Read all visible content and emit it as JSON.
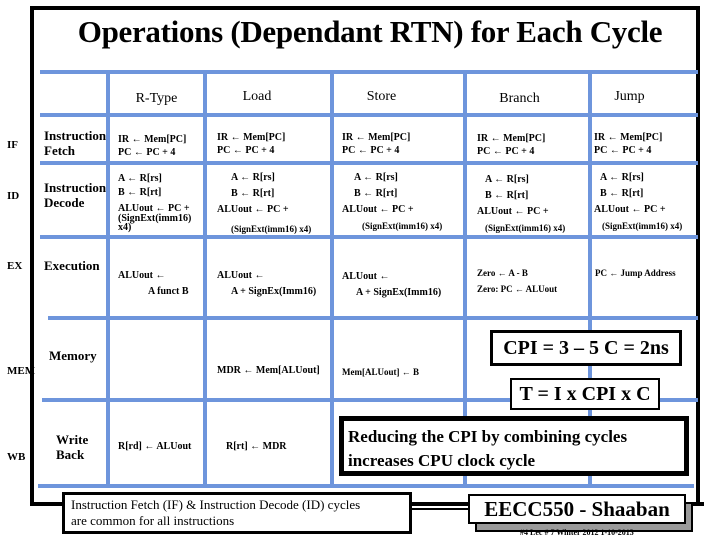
{
  "title": "Operations (Dependant RTN) for Each Cycle",
  "columns": [
    "R-Type",
    "Load",
    "Store",
    "Branch",
    "Jump"
  ],
  "stages": [
    {
      "abbr": "IF",
      "name_lines": [
        "Instruction",
        "Fetch"
      ]
    },
    {
      "abbr": "ID",
      "name_lines": [
        "Instruction",
        "Decode"
      ]
    },
    {
      "abbr": "EX",
      "name_lines": [
        "Execution"
      ]
    },
    {
      "abbr": "MEM",
      "name_lines": [
        "Memory"
      ]
    },
    {
      "abbr": "WB",
      "name_lines": [
        "Write",
        "Back"
      ]
    }
  ],
  "cells": {
    "IF": {
      "rtype": [
        "IR ← Mem[PC]",
        "PC ← PC + 4"
      ],
      "load": [
        "IR ←  Mem[PC]",
        "PC ← PC + 4"
      ],
      "store": [
        "IR ←  Mem[PC]",
        "PC ← PC + 4"
      ],
      "branch": [
        "IR ← Mem[PC]",
        "PC ← PC + 4"
      ],
      "jump": [
        "IR ← Mem[PC]",
        "PC ← PC + 4"
      ]
    },
    "ID": {
      "rtype": [
        "A ←  R[rs]",
        "B ←  R[rt]",
        "ALUout ← PC +",
        "(SignExt(imm16)",
        "x4)"
      ],
      "load": [
        "A ← R[rs]",
        "B ← R[rt]",
        "ALUout ← PC +",
        "(SignExt(imm16) x4)"
      ],
      "store": [
        "A ←  R[rs]",
        "B ←  R[rt]",
        "ALUout ← PC +",
        "(SignExt(imm16) x4)"
      ],
      "branch": [
        "A ←  R[rs]",
        "B ←  R[rt]",
        "ALUout ← PC +",
        "(SignExt(imm16) x4)"
      ],
      "jump": [
        "A ←  R[rs]",
        "B ←  R[rt]",
        "ALUout ← PC +",
        "(SignExt(imm16) x4)"
      ]
    },
    "EX": {
      "rtype": [
        "ALUout ←",
        "A funct  B"
      ],
      "load": [
        "ALUout ←",
        "A + SignEx(Imm16)"
      ],
      "store": [
        "ALUout ←",
        "A + SignEx(Imm16)"
      ],
      "branch": [
        "Zero ← A - B",
        "Zero:  PC ←  ALUout"
      ],
      "jump": [
        "PC ← Jump Address"
      ]
    },
    "MEM": {
      "load": [
        "MDR ←  Mem[ALUout]"
      ],
      "store": [
        "Mem[ALUout]   ←  B"
      ]
    },
    "WB": {
      "rtype": [
        "R[rd] ← ALUout"
      ],
      "load": [
        "R[rt]  ←  MDR"
      ]
    }
  },
  "callouts": {
    "cpi": "CPI = 3 – 5   C = 2ns",
    "time_eq": "T = I x CPI x C",
    "reduce_lines": [
      "Reducing the CPI by combining cycles",
      "increases CPU clock cycle"
    ],
    "common_lines": [
      "Instruction Fetch (IF) & Instruction Decode (ID) cycles",
      "are common for all instructions"
    ],
    "course": "EECC550 - Shaaban"
  },
  "footer": "#4   Lec # 7  Winter 2012  1-10-2013",
  "colors": {
    "grid": "#6e95dc",
    "frame": "#000000",
    "shadow": "#9a9a9a"
  }
}
